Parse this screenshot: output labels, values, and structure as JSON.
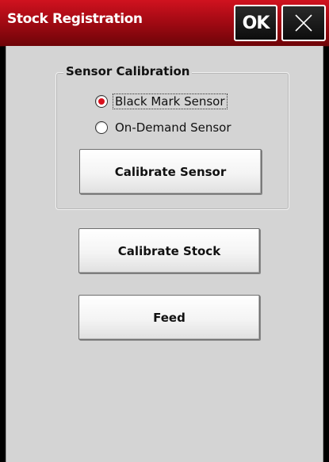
{
  "window": {
    "title": "Stock Registration",
    "ok_label": "OK",
    "close_icon": "close-icon",
    "accent_color": "#c0101c"
  },
  "sensor_calibration": {
    "group_title": "Sensor Calibration",
    "options": [
      {
        "label": "Black Mark Sensor",
        "selected": true
      },
      {
        "label": "On-Demand Sensor",
        "selected": false
      }
    ],
    "calibrate_sensor_label": "Calibrate Sensor"
  },
  "actions": {
    "calibrate_stock_label": "Calibrate Stock",
    "feed_label": "Feed"
  }
}
